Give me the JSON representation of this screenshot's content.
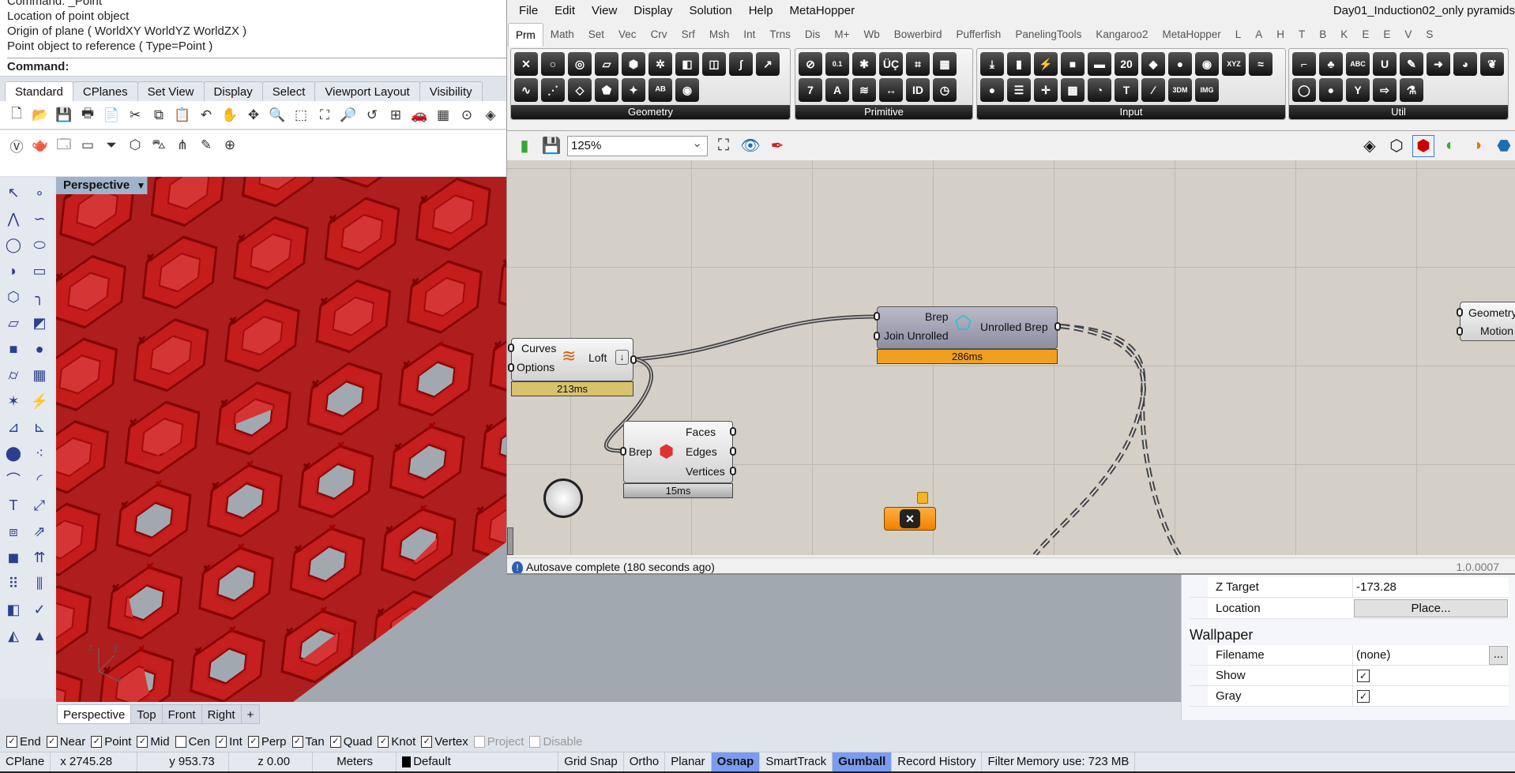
{
  "rhino": {
    "command_history": [
      "Command: _Point",
      "Location of point object",
      "Origin of plane ( WorldXY  WorldYZ  WorldZX )",
      "Point object to reference ( Type=Point )"
    ],
    "command_prompt": "Command:",
    "toolbar_tabs": [
      "Standard",
      "CPlanes",
      "Set View",
      "Display",
      "Select",
      "Viewport Layout",
      "Visibility"
    ],
    "active_tab": "Standard",
    "toolbar_row1": [
      [
        "new-file-icon",
        "🗋"
      ],
      [
        "open-folder-icon",
        "📂"
      ],
      [
        "save-icon",
        "💾"
      ],
      [
        "print-icon",
        "🖶"
      ],
      [
        "import-icon",
        "📄"
      ],
      [
        "cut-icon",
        "✂"
      ],
      [
        "copy-icon",
        "⧉"
      ],
      [
        "paste-icon",
        "📋"
      ],
      [
        "undo-icon",
        "↶"
      ],
      [
        "pan-icon",
        "✋"
      ],
      [
        "rotate-view-icon",
        "✥"
      ],
      [
        "zoom-icon",
        "🔍"
      ],
      [
        "zoom-window-icon",
        "⬚"
      ],
      [
        "zoom-extents-icon",
        "⛶"
      ],
      [
        "zoom-selected-icon",
        "🔎"
      ],
      [
        "undo-view-icon",
        "↺"
      ],
      [
        "four-viewports-icon",
        "⊞"
      ],
      [
        "car-icon",
        "🚗"
      ],
      [
        "grid-icon",
        "▦"
      ],
      [
        "circle-point-icon",
        "⊙"
      ],
      [
        "object-snap-icon",
        "◈"
      ],
      [
        "lightbulb-icon",
        "💡"
      ]
    ],
    "toolbar_row2": [
      [
        "vray-icon",
        "Ⓥ"
      ],
      [
        "teapot-icon",
        "🫖"
      ],
      [
        "render-window-icon",
        "🗔"
      ],
      [
        "frame-icon",
        "▭"
      ],
      [
        "funnel-icon",
        "⏷"
      ],
      [
        "box-light-icon",
        "⬡"
      ],
      [
        "car-window-icon",
        "⛍"
      ],
      [
        "grass-icon",
        "⋔"
      ],
      [
        "pencil-tag-icon",
        "✎"
      ],
      [
        "target-icon",
        "⊕"
      ]
    ],
    "left_toolbar": [
      [
        "select-arrow-icon",
        "↖"
      ],
      [
        "point-icon",
        "∘"
      ],
      [
        "polyline-icon",
        "⋀"
      ],
      [
        "curve-icon",
        "∽"
      ],
      [
        "circle-icon",
        "◯"
      ],
      [
        "ellipse-icon",
        "⬭"
      ],
      [
        "arc-icon",
        "◗"
      ],
      [
        "rectangle-icon",
        "▭"
      ],
      [
        "polygon-icon",
        "⬡"
      ],
      [
        "fillet-curve-icon",
        "╮"
      ],
      [
        "surface-pts-icon",
        "▱"
      ],
      [
        "extrude-surface-icon",
        "◩"
      ],
      [
        "box-icon",
        "■"
      ],
      [
        "sphere-union-icon",
        "●"
      ],
      [
        "cylinder-icon",
        "⌭"
      ],
      [
        "mesh-icon",
        "▦"
      ],
      [
        "explode-icon",
        "✶"
      ],
      [
        "fire-icon",
        "⚡"
      ],
      [
        "split-icon",
        "⊿"
      ],
      [
        "trim-icon",
        "⊾"
      ],
      [
        "boolean-icon",
        "⬤"
      ],
      [
        "dots-icon",
        "⁖"
      ],
      [
        "curve-offset-icon",
        "⌒"
      ],
      [
        "fillet-edge-icon",
        "◜"
      ],
      [
        "text-icon",
        "T"
      ],
      [
        "scale-icon",
        "⤢"
      ],
      [
        "array-icon",
        "⧈"
      ],
      [
        "project-icon",
        "⇗"
      ],
      [
        "solid-box-icon",
        "◼"
      ],
      [
        "arrows-up-icon",
        "⇈"
      ],
      [
        "grid-array-icon",
        "⠿"
      ],
      [
        "dimension-icon",
        "⫼"
      ],
      [
        "layer-icon",
        "◧"
      ],
      [
        "check-icon",
        "✓"
      ],
      [
        "shapes-icon",
        "◭"
      ],
      [
        "pyramid-light-icon",
        "▲"
      ]
    ],
    "viewport_title": "Perspective",
    "viewport_tabs": [
      "Perspective",
      "Top",
      "Front",
      "Right",
      "+"
    ],
    "axis_labels": {
      "x": "x",
      "y": "y",
      "z": "z"
    },
    "osnaps": [
      {
        "label": "End",
        "checked": true
      },
      {
        "label": "Near",
        "checked": true
      },
      {
        "label": "Point",
        "checked": true
      },
      {
        "label": "Mid",
        "checked": true
      },
      {
        "label": "Cen",
        "checked": false
      },
      {
        "label": "Int",
        "checked": true
      },
      {
        "label": "Perp",
        "checked": true
      },
      {
        "label": "Tan",
        "checked": true
      },
      {
        "label": "Quad",
        "checked": true
      },
      {
        "label": "Knot",
        "checked": true
      },
      {
        "label": "Vertex",
        "checked": true
      },
      {
        "label": "Project",
        "checked": false,
        "disabled": true
      },
      {
        "label": "Disable",
        "checked": false,
        "disabled": true
      }
    ],
    "status": {
      "cplane": "CPlane",
      "x": "x 2745.28",
      "y": "y 953.73",
      "z": "z 0.00",
      "units": "Meters",
      "layer": "Default",
      "grid_snap": "Grid Snap",
      "ortho": "Ortho",
      "planar": "Planar",
      "osnap": "Osnap",
      "smarttrack": "SmartTrack",
      "gumball": "Gumball",
      "record_history": "Record History",
      "filter": "Filter",
      "memory": "Memory use: 723 MB"
    },
    "properties": {
      "z_target_label": "Z Target",
      "z_target_value": "-173.28",
      "location_label": "Location",
      "location_button": "Place...",
      "wallpaper_heading": "Wallpaper",
      "filename_label": "Filename",
      "filename_value": "(none)",
      "browse_button": "...",
      "show_label": "Show",
      "show_checked": true,
      "gray_label": "Gray",
      "gray_checked": true
    }
  },
  "grasshopper": {
    "menu": [
      "File",
      "Edit",
      "View",
      "Display",
      "Solution",
      "Help",
      "MetaHopper"
    ],
    "title": "Day01_Induction02_only pyramids",
    "tabs": [
      "Prm",
      "Math",
      "Set",
      "Vec",
      "Crv",
      "Srf",
      "Msh",
      "Int",
      "Trns",
      "Dis",
      "M+",
      "Wb",
      "Bowerbird",
      "Pufferfish",
      "PanelingTools",
      "Kangaroo2",
      "MetaHopper",
      "L",
      "A",
      "H",
      "T",
      "B",
      "K",
      "E",
      "E",
      "V",
      "S"
    ],
    "active_tab": "Prm",
    "groups": [
      {
        "label": "Geometry",
        "icons": [
          [
            "x-param-icon",
            "✕"
          ],
          [
            "circle-param-icon",
            "○"
          ],
          [
            "arc-param-icon",
            "◎"
          ],
          [
            "box-param-icon",
            "▱"
          ],
          [
            "brep-param-icon",
            "⬢"
          ],
          [
            "mesh-param-icon",
            "✲"
          ],
          [
            "surface-param-icon",
            "◧"
          ],
          [
            "twisted-box-icon",
            "◫"
          ],
          [
            "curve-param-icon",
            "∫"
          ],
          [
            "line-param-icon",
            "↗"
          ],
          [
            "polyline-param-icon",
            "∿"
          ],
          [
            "point-param-icon",
            "⋰"
          ],
          [
            "plane-param-icon",
            "◇"
          ],
          [
            "face-param-icon",
            "⬟"
          ],
          [
            "edge-param-icon",
            "✦"
          ],
          [
            "geometry-pipeline-icon",
            "ᴬᴮ"
          ],
          [
            "group-param-icon",
            "◉"
          ]
        ]
      },
      {
        "label": "Primitive",
        "icons": [
          [
            "boolean-param-icon",
            "⊘"
          ],
          [
            "number-param-icon",
            "0.1"
          ],
          [
            "vector-param-icon",
            "✱"
          ],
          [
            "culture-param-icon",
            "ÜÇ"
          ],
          [
            "domain-param-icon",
            "⌗"
          ],
          [
            "matrix-param-icon",
            "▦"
          ],
          [
            "integer-param-icon",
            "7"
          ],
          [
            "text-param-icon",
            "A"
          ],
          [
            "shader-param-icon",
            "≋"
          ],
          [
            "domain2-param-icon",
            "↔"
          ],
          [
            "guid-param-icon",
            "ID"
          ],
          [
            "time-param-icon",
            "◷"
          ]
        ]
      },
      {
        "label": "Input",
        "icons": [
          [
            "data-input-icon",
            "⤓"
          ],
          [
            "toggle-icon",
            "▮"
          ],
          [
            "button-icon",
            "⚡"
          ],
          [
            "panel-icon",
            "■"
          ],
          [
            "slider-icon",
            "▬"
          ],
          [
            "calendar-icon",
            "20"
          ],
          [
            "colour-swatch-icon",
            "◆"
          ],
          [
            "colour-wheel-icon",
            "●"
          ],
          [
            "camera-icon",
            "◉"
          ],
          [
            "xyz-icon",
            "XYZ"
          ],
          [
            "graph-mapper-icon",
            "≈"
          ],
          [
            "knob-icon",
            "●"
          ],
          [
            "value-list-icon",
            "☰"
          ],
          [
            "md-slider-icon",
            "✛"
          ],
          [
            "gradient-icon",
            "▩"
          ],
          [
            "clock-icon",
            "◔"
          ],
          [
            "image-sampler-icon",
            "T"
          ],
          [
            "curve-graph-icon",
            "∕"
          ],
          [
            "3dm-icon",
            "3DM"
          ],
          [
            "img-icon",
            "IMG"
          ]
        ]
      },
      {
        "label": "Util",
        "icons": [
          [
            "glasses-icon",
            "⌐"
          ],
          [
            "tree-icon",
            "♣"
          ],
          [
            "abc-icon",
            "ABC"
          ],
          [
            "magnet-icon",
            "U"
          ],
          [
            "pencil-icon",
            "✎"
          ],
          [
            "arrow-right-icon",
            "➜"
          ],
          [
            "eye-icon",
            "◕"
          ],
          [
            "cherry-icon",
            "❦"
          ],
          [
            "ring-icon",
            "◯"
          ],
          [
            "record-icon",
            "●"
          ],
          [
            "y-icon",
            "Y"
          ],
          [
            "outline-arrow-icon",
            "⇨"
          ],
          [
            "flask-icon",
            "⚗"
          ]
        ]
      }
    ],
    "zoom_level": "125%",
    "components": {
      "loft": {
        "inputs": [
          "Curves",
          "Options"
        ],
        "name": "Loft",
        "time": "213ms"
      },
      "unroll": {
        "inputs": [
          "Brep",
          "Join Unrolled"
        ],
        "output": "Unrolled Brep",
        "time": "286ms"
      },
      "deconstruct": {
        "input": "Brep",
        "outputs": [
          "Faces",
          "Edges",
          "Vertices"
        ],
        "time": "15ms"
      },
      "right": {
        "inputs": [
          "Geometry",
          "Motion"
        ]
      }
    },
    "status_message": "Autosave complete (180 seconds ago)",
    "version": "1.0.0007"
  }
}
